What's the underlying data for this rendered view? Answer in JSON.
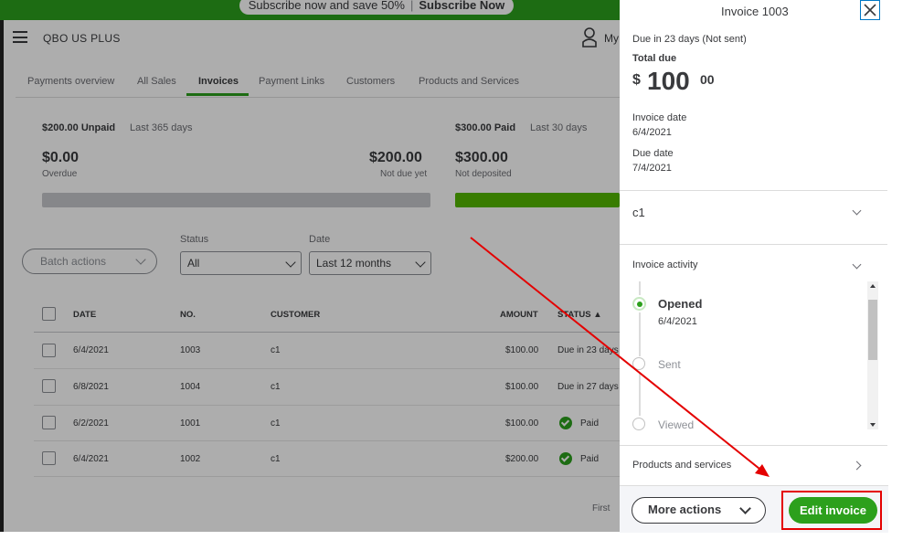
{
  "promo": {
    "text": "Subscribe now and save 50%",
    "cta": "Subscribe Now"
  },
  "header": {
    "company": "QBO US PLUS",
    "user_label": "My"
  },
  "tabs": [
    "Payments overview",
    "All Sales",
    "Invoices",
    "Payment Links",
    "Customers",
    "Products and Services"
  ],
  "summary": {
    "unpaid_title": "$200.00 Unpaid",
    "unpaid_period": "Last 365 days",
    "overdue_amount": "$0.00",
    "overdue_label": "Overdue",
    "not_due_amount": "$200.00",
    "not_due_label": "Not due yet",
    "paid_title": "$300.00 Paid",
    "paid_period": "Last 30 days",
    "not_deposited_amount": "$300.00",
    "not_deposited_label": "Not deposited"
  },
  "filters": {
    "batch_actions": "Batch actions",
    "status_label": "Status",
    "status_value": "All",
    "date_label": "Date",
    "date_value": "Last 12 months"
  },
  "table": {
    "headers": {
      "date": "DATE",
      "no": "NO.",
      "customer": "CUSTOMER",
      "amount": "AMOUNT",
      "status": "STATUS ▲"
    },
    "rows": [
      {
        "date": "6/4/2021",
        "no": "1003",
        "customer": "c1",
        "amount": "$100.00",
        "status": "Due in 23 days"
      },
      {
        "date": "6/8/2021",
        "no": "1004",
        "customer": "c1",
        "amount": "$100.00",
        "status": "Due in 27 days"
      },
      {
        "date": "6/2/2021",
        "no": "1001",
        "customer": "c1",
        "amount": "$100.00",
        "status": "Paid"
      },
      {
        "date": "6/4/2021",
        "no": "1002",
        "customer": "c1",
        "amount": "$200.00",
        "status": "Paid"
      }
    ],
    "pagination_first": "First"
  },
  "drawer": {
    "title": "Invoice 1003",
    "due_status": "Due in 23 days (Not sent)",
    "total_due_label": "Total due",
    "currency": "$",
    "total_whole": "100",
    "total_cents": "00",
    "invoice_date_label": "Invoice date",
    "invoice_date": "6/4/2021",
    "due_date_label": "Due date",
    "due_date": "7/4/2021",
    "customer": "c1",
    "activity_title": "Invoice activity",
    "activity": [
      {
        "label": "Opened",
        "date": "6/4/2021"
      },
      {
        "label": "Sent"
      },
      {
        "label": "Viewed"
      }
    ],
    "products_label": "Products and services",
    "more_actions": "More actions",
    "edit_invoice": "Edit invoice"
  }
}
